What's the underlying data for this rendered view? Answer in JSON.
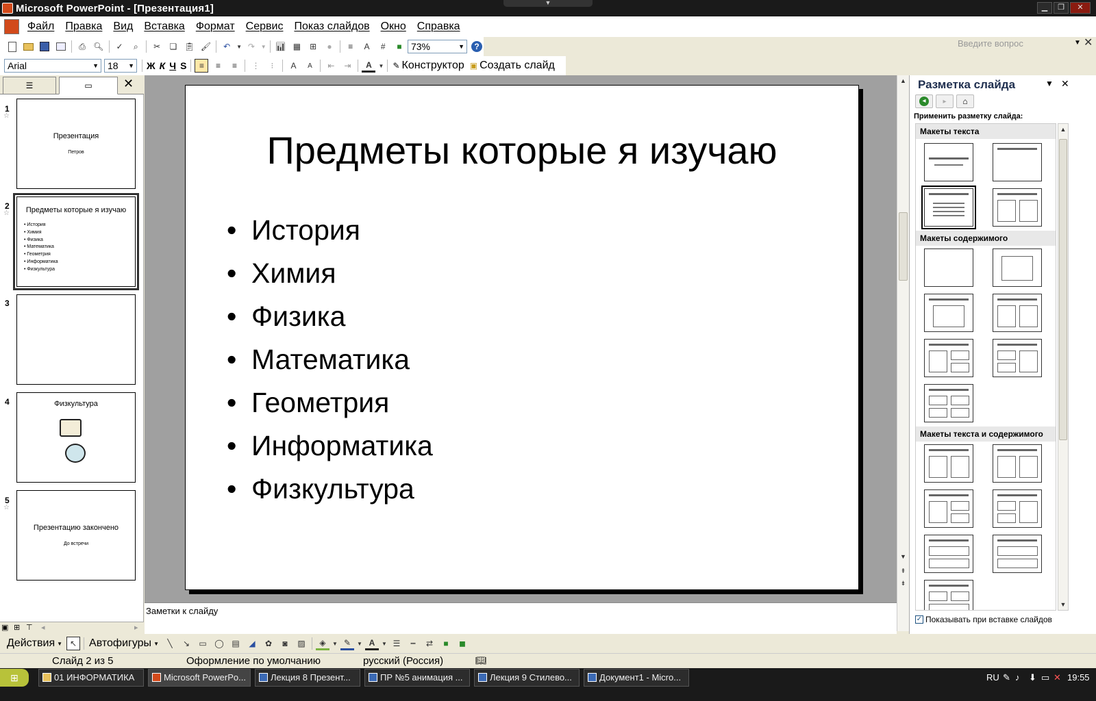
{
  "window": {
    "title": "Microsoft PowerPoint - [Презентация1]"
  },
  "menu": {
    "items": [
      "Файл",
      "Правка",
      "Вид",
      "Вставка",
      "Формат",
      "Сервис",
      "Показ слайдов",
      "Окно",
      "Справка"
    ],
    "help_placeholder": "Введите вопрос"
  },
  "toolbar": {
    "zoom": "73%"
  },
  "format_toolbar": {
    "font": "Arial",
    "size": "18",
    "bold": "Ж",
    "italic": "К",
    "underline": "Ч",
    "shadow": "S",
    "designer": "Конструктор",
    "new_slide": "Создать слайд"
  },
  "thumbnails": [
    {
      "num": "1",
      "title": "Презентация",
      "subtitle": "Петров"
    },
    {
      "num": "2",
      "title": "Предметы которые я изучаю",
      "items": [
        "История",
        "Химия",
        "Физика",
        "Математика",
        "Геометрия",
        "Информатика",
        "Физкультура"
      ]
    },
    {
      "num": "3"
    },
    {
      "num": "4",
      "title": "Физкультура"
    },
    {
      "num": "5",
      "title": "Презентацию закончено",
      "subtitle": "До встречи"
    }
  ],
  "slide": {
    "title": "Предметы которые я изучаю",
    "bullets": [
      "История",
      "Химия",
      "Физика",
      "Математика",
      "Геометрия",
      "Информатика",
      "Физкультура"
    ]
  },
  "notes": {
    "placeholder": "Заметки к слайду"
  },
  "taskpane": {
    "title": "Разметка слайда",
    "apply_label": "Применить разметку слайда:",
    "sections": [
      "Макеты текста",
      "Макеты содержимого",
      "Макеты текста и содержимого"
    ],
    "show_on_insert": "Показывать при вставке слайдов"
  },
  "drawbar": {
    "actions": "Действия",
    "autoshapes": "Автофигуры"
  },
  "status": {
    "slide": "Слайд 2 из 5",
    "design": "Оформление по умолчанию",
    "language": "русский (Россия)"
  },
  "taskbar": {
    "start": "пуск",
    "tasks": [
      "01 ИНФОРМАТИКА",
      "Microsoft PowerPo...",
      "Лекция 8 Презент...",
      "ПР №5 анимация ...",
      "Лекция 9 Стилево...",
      "Документ1 - Micro..."
    ],
    "lang": "RU",
    "clock": "19:55"
  },
  "colors": {
    "titlebar": "#1a1a1a",
    "chrome": "#ece9d8",
    "slide_bg": "#ffffff",
    "workspace": "#a0a0a0"
  }
}
